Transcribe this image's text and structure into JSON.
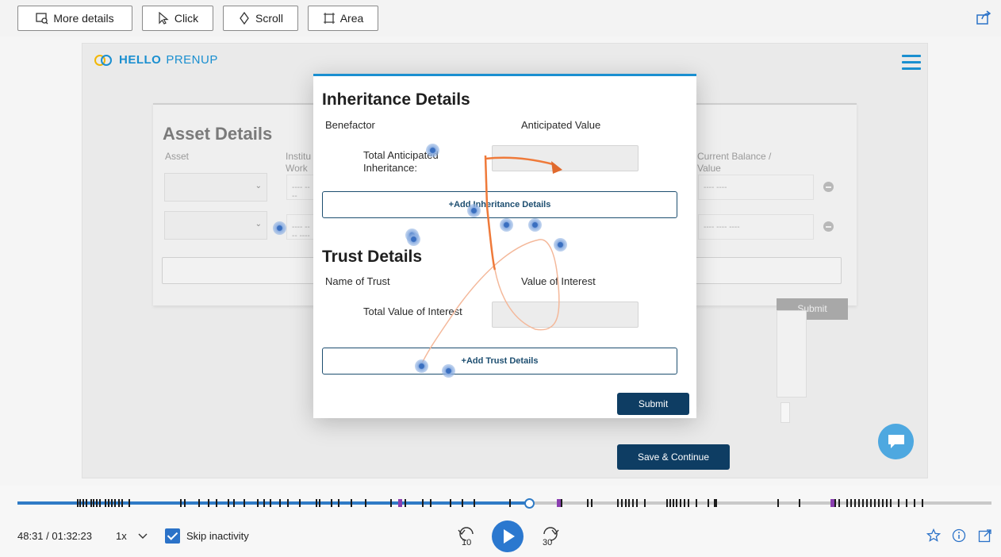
{
  "toolbar": {
    "more_details": "More details",
    "click": "Click",
    "scroll": "Scroll",
    "area": "Area"
  },
  "app": {
    "logo_part1": "HELLO",
    "logo_part2": "PRENUP",
    "brand_color": "#1a8fd0"
  },
  "background_form": {
    "title": "Asset Details",
    "col_asset": "Asset",
    "col_institution": "Institu Work",
    "col_balance": "Current Balance / Value",
    "row1_masked": "---- ----",
    "row2_masked": "---- ---- ----",
    "submit": "Submit"
  },
  "modal": {
    "inheritance_title": "Inheritance Details",
    "benefactor_label": "Benefactor",
    "anticipated_value_label": "Anticipated Value",
    "total_anticipated_label": "Total Anticipated Inheritance:",
    "add_inheritance": "+Add Inheritance Details",
    "trust_title": "Trust Details",
    "name_of_trust_label": "Name of Trust",
    "value_of_interest_label": "Value of Interest",
    "total_value_interest_label": "Total Value of Interest",
    "add_trust": "+Add Trust Details",
    "submit": "Submit"
  },
  "page": {
    "save_continue": "Save & Continue"
  },
  "player": {
    "time": "48:31 / 01:32:23",
    "speed": "1x",
    "skip_inactivity": "Skip inactivity",
    "skip_inactivity_checked": true,
    "rewind_seconds": "10",
    "forward_seconds": "30",
    "progress_fraction": 0.525
  }
}
